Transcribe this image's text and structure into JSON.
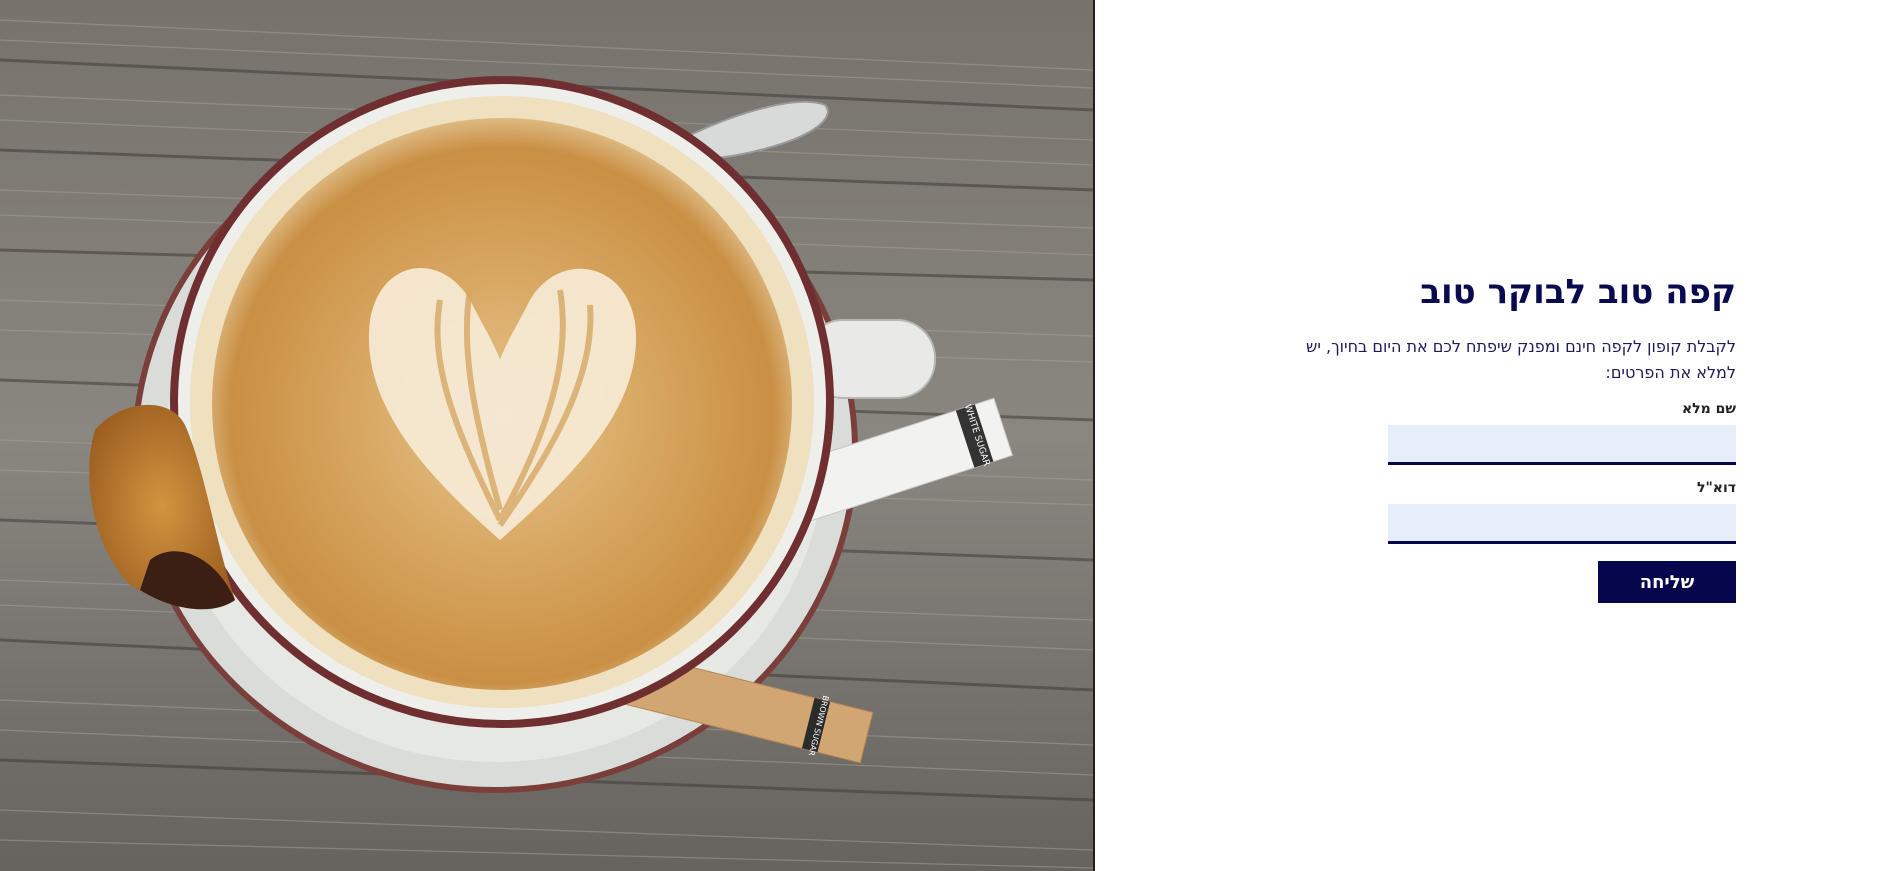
{
  "hero": {
    "title": "קפה טוב לבוקר טוב",
    "intro": "לקבלת קופון לקפה חינם ומפנק שיפתח לכם את היום בחיוך, יש למלא את הפרטים:"
  },
  "form": {
    "name_label": "שם מלא",
    "name_value": "",
    "email_label": "דוא\"ל",
    "email_value": "",
    "submit_label": "שליחה"
  },
  "photo": {
    "sugar_white_label": "WHITE SUGAR",
    "sugar_brown_label": "BROWN SUGAR"
  },
  "colors": {
    "brand": "#06064d",
    "input_bg": "#e6edfb"
  }
}
